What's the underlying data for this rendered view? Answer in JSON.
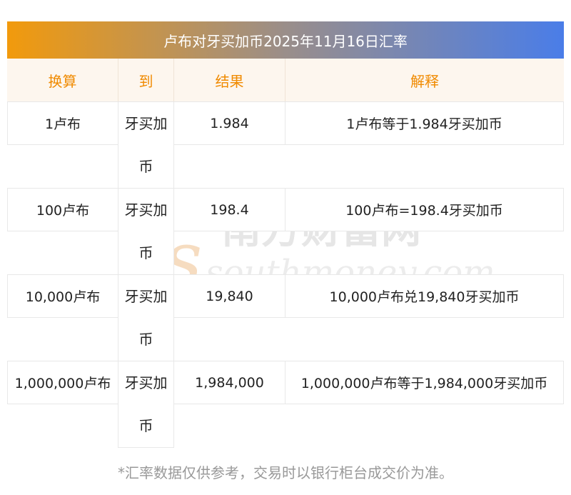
{
  "title": "卢布对牙买加币2025年11月16日汇率",
  "headers": [
    "换算",
    "到",
    "结果",
    "解释"
  ],
  "rows": [
    {
      "amount": "1卢布",
      "unit": "牙买加币",
      "result": "1.984",
      "explain": "1卢布等于1.984牙买加币"
    },
    {
      "amount": "100卢布",
      "unit": "牙买加币",
      "result": "198.4",
      "explain": "100卢布=198.4牙买加币"
    },
    {
      "amount": "10,000卢布",
      "unit": "牙买加币",
      "result": "19,840",
      "explain": "10,000卢布兑19,840牙买加币"
    },
    {
      "amount": "1,000,000卢布",
      "unit": "牙买加币",
      "result": "1,984,000",
      "explain": "1,000,000卢布等于1,984,000牙买加币"
    }
  ],
  "watermark": {
    "cn": "南方财富网",
    "en": "southmoney.com"
  },
  "note": "*汇率数据仅供参考，交易时以银行柜台成交价为准。",
  "colors": {
    "accent": "#f08a00",
    "gradient_start": "#f29a0c",
    "gradient_end": "#4a7de8",
    "watermark": "#e6e6e6",
    "watermark_s": "#f6dcc0"
  }
}
